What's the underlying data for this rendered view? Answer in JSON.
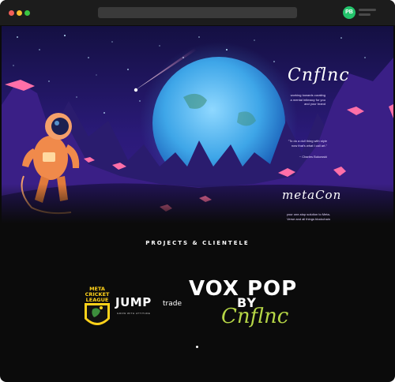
{
  "browser": {
    "avatar_initials": "PB",
    "traffic_lights": [
      "#f25f58",
      "#f7be2f",
      "#3bc642"
    ]
  },
  "hero": {
    "brand_logo": "Cnflnc",
    "tagline": "working towards curating a mental intimacy for you and your brand",
    "quote": "\"To do a dull thing with style now that's what I call art.\"",
    "quote_author": "~ Charles Bukowski",
    "meta_logo": "metaCon",
    "meta_desc": "your one-stop solution to Meta-Verse and all things blockchain",
    "colors": {
      "sky_top": "#1b1250",
      "sky_bottom": "#3d1e8f",
      "planet": "#3ea6e8",
      "accent_pink": "#ff6fa8"
    }
  },
  "projects": {
    "title": "PROJECTS & CLIENTELE",
    "clients": {
      "mcl": {
        "line1": "META",
        "line2": "CRICKET",
        "line3": "LEAGUE"
      },
      "jump": {
        "name": "JUMP",
        "suffix": "trade",
        "tagline": "GROW WITH ATTITUDE"
      },
      "voxpop": {
        "name": "VOX POP",
        "by": "BY",
        "script": "Cnflnc"
      }
    },
    "colors": {
      "mcl_yellow": "#ffd21a",
      "voxpop_green": "#b6d646"
    }
  }
}
